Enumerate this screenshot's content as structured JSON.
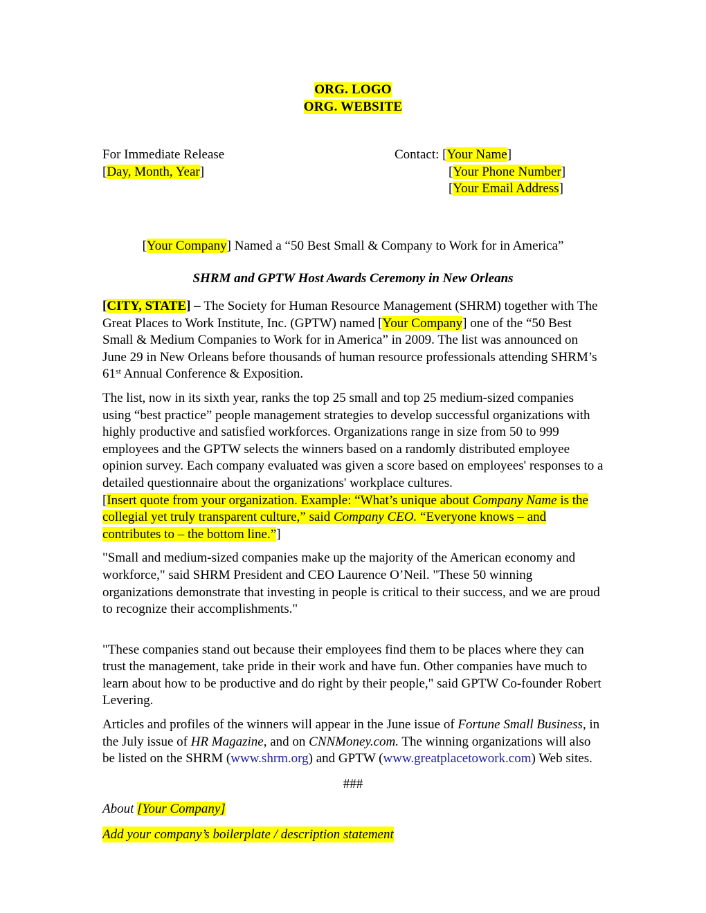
{
  "colors": {
    "highlight": "#ffff00",
    "text": "#000000",
    "link": "#20209c",
    "page_background": "#ffffff"
  },
  "header": {
    "org_logo": "ORG. LOGO",
    "org_website": "ORG. WEBSITE"
  },
  "release_info": {
    "for_immediate_release": "For Immediate Release",
    "date_placeholder": "Day, Month, Year",
    "contact_label": "Contact:",
    "contact_name": "Your Name",
    "contact_phone": "Your Phone Number",
    "contact_email": "Your Email Address",
    "bracket_open": "[",
    "bracket_close": "]"
  },
  "headline": {
    "company_placeholder": "Your Company",
    "rest": "] Named a “50 Best Small & Company to Work for in America”",
    "open_bracket": "[",
    "subhead": "SHRM and GPTW Host Awards Ceremony in New Orleans"
  },
  "body": {
    "p1": {
      "dateline_open": "[",
      "dateline": "CITY, STATE",
      "dateline_close": "] – ",
      "seg1": "  The Society for Human Resource Management (SHRM) together with The Great Places to Work Institute, Inc. (GPTW) named [",
      "company": "Your Company",
      "seg2": "] one of the “50 Best Small & Medium Companies to Work for in America” in 2009. The list was announced on June 29 in New Orleans before thousands of human resource professionals attending SHRM’s 61",
      "ordinal": "st",
      "seg3": " Annual Conference & Exposition."
    },
    "p2": "The list, now in its sixth year, ranks the top 25 small and top 25 medium-sized companies using “best practice” people management strategies to develop successful organizations with highly productive and satisfied workforces. Organizations range in size from 50 to 999 employees and the GPTW selects the winners based on a randomly distributed employee opinion survey. Each company evaluated was given a score based on employees' responses to a detailed questionnaire about the organizations' workplace cultures.",
    "quote_placeholder": {
      "open_bracket": "[",
      "seg1": "Insert quote from your organization.  Example: “What’s unique about ",
      "company_name": "Company Name",
      "seg2": " is the collegial yet truly transparent culture,” said ",
      "company_ceo": "Company CEO.",
      "seg3": "  “Everyone knows – and contributes to – the bottom line.”",
      "close_bracket": "]"
    },
    "p3": "\"Small and medium-sized companies make up the majority of the American economy and workforce,\" said SHRM President and CEO Laurence O’Neil. \"These 50 winning organizations demonstrate that investing in people is critical to their success, and we are proud to recognize their accomplishments.\"",
    "p4": "\"These companies stand out because their employees find them to be places where they can trust the management, take pride in their work and have fun. Other companies have much to learn about how to be productive and do right by their people,\" said GPTW Co-founder Robert Levering.",
    "p5": {
      "seg1": "Articles and profiles of the winners will appear in the June issue of ",
      "pub1": "Fortune Small Business,",
      "seg2": " in the July issue of ",
      "pub2": "HR Magazine",
      "seg3": ", and on ",
      "pub3": "CNNMoney.com.",
      "seg4": "  The winning organizations will also be listed on the SHRM (",
      "link1": "www.shrm.org",
      "seg5": ") and GPTW (",
      "link2": "www.greatplacetowork.com",
      "seg6": ") Web sites."
    }
  },
  "footer": {
    "separator": "###",
    "about_label": "About ",
    "about_company": "[Your Company]",
    "boilerplate": "Add your company’s boilerplate / description statement"
  }
}
